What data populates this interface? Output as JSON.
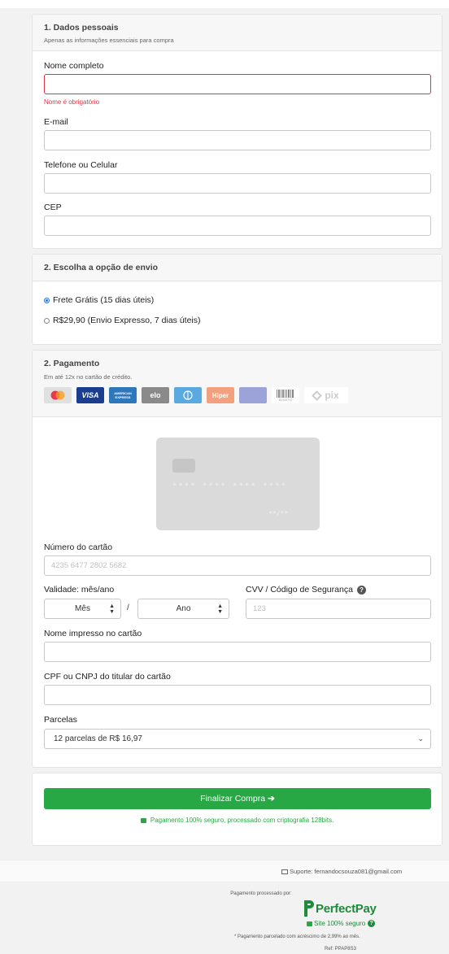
{
  "personal": {
    "title": "1. Dados pessoais",
    "subtitle": "Apenas as informações essenciais para compra",
    "name_label": "Nome completo",
    "name_error": "Nome é obrigatório",
    "email_label": "E-mail",
    "phone_label": "Telefone ou Celular",
    "cep_label": "CEP"
  },
  "shipping": {
    "title": "2. Escolha a opção de envio",
    "options": [
      {
        "label": "Frete Grátis (15 dias úteis)",
        "selected": true
      },
      {
        "label": "R$29,90 (Envio Expresso, 7 dias úteis)",
        "selected": false
      }
    ]
  },
  "payment": {
    "title": "2. Pagamento",
    "subtitle": "Em até 12x no cartão de crédito.",
    "methods": [
      {
        "name": "mastercard",
        "label": "",
        "color": "#eb6b2f"
      },
      {
        "name": "visa",
        "label": "VISA",
        "color": "#1a3d8f"
      },
      {
        "name": "amex",
        "label": "AMERICAN EXPRESS",
        "color": "#2e77bb"
      },
      {
        "name": "elo",
        "label": "elo",
        "color": "#6d6e71"
      },
      {
        "name": "diners",
        "label": "",
        "color": "#1f8fd6"
      },
      {
        "name": "hipercard",
        "label": "Hiper",
        "color": "#e8522d"
      },
      {
        "name": "other-card",
        "label": "",
        "color": "#2a3a9a"
      },
      {
        "name": "boleto",
        "label": "BOLETO",
        "color": "#ffffff"
      },
      {
        "name": "pix",
        "label": "pix",
        "color": "#ffffff"
      }
    ],
    "card_preview": {
      "number": "**** **** **** ****",
      "expiry": "**/**"
    },
    "card_number_label": "Número do cartão",
    "card_number_placeholder": "4235 6477 2802 5682",
    "validity_label": "Validade: mês/ano",
    "month_value": "Mês",
    "year_value": "Ano",
    "separator": "/",
    "cvv_label": "CVV / Código de Segurança",
    "cvv_placeholder": "123",
    "holder_label": "Nome impresso no cartão",
    "doc_label": "CPF ou CNPJ do titular do cartão",
    "installments_label": "Parcelas",
    "installments_value": "12 parcelas de R$ 16,97"
  },
  "checkout": {
    "button_label": "Finalizar Compra",
    "secure_text": "Pagamento 100% seguro, processado com criptografia 128bits."
  },
  "footer": {
    "support": "Suporte: fernandocsouza081@gmail.com",
    "processed_by": "Pagamento processado por:",
    "brand": "PerfectPay",
    "site_secure": "Site 100% seguro",
    "interest_note": "* Pagamento parcelado com acréscimo de 2,99% ao mês.",
    "ref": "Ref: PPAP8S3"
  },
  "colors": {
    "accent_green": "#28a745",
    "error_red": "#dc3545",
    "brand_green": "#1e8a3c"
  }
}
